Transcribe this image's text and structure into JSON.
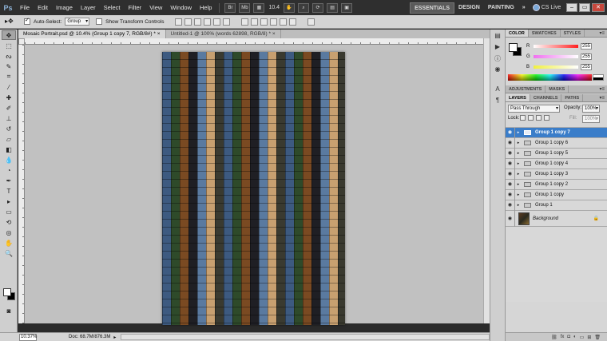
{
  "app": {
    "logo": "Ps"
  },
  "menu": [
    "File",
    "Edit",
    "Image",
    "Layer",
    "Select",
    "Filter",
    "View",
    "Window",
    "Help"
  ],
  "appbar": {
    "zoom": "10.4"
  },
  "workspace": {
    "items": [
      "ESSENTIALS",
      "DESIGN",
      "PAINTING",
      "»"
    ],
    "cslive": "CS Live"
  },
  "options": {
    "auto_select_label": "Auto-Select:",
    "auto_select_value": "Group",
    "transform_label": "Show Transform Controls"
  },
  "tabs": [
    {
      "label": "Mosaic Portrait.psd @ 10.4% (Group 1 copy 7, RGB/8#) *",
      "close": "×"
    },
    {
      "label": "Untitled-1 @ 100% (words 62898, RGB/8) *",
      "close": "×"
    }
  ],
  "status": {
    "zoom": "10.37%",
    "doc": "Doc: 68.7M/876.3M"
  },
  "color_panel": {
    "tabs": [
      "COLOR",
      "SWATCHES",
      "STYLES"
    ],
    "rows": [
      {
        "letter": "R",
        "value": "255",
        "color": "#ff2020"
      },
      {
        "letter": "G",
        "value": "255",
        "color": "#20ff20"
      },
      {
        "letter": "B",
        "value": "255",
        "color": "#3030ff"
      }
    ]
  },
  "adjust_tabs": [
    "ADJUSTMENTS",
    "MASKS"
  ],
  "layers_panel": {
    "tabs": [
      "LAYERS",
      "CHANNELS",
      "PATHS"
    ],
    "blend_mode": "Pass Through",
    "opacity_label": "Opacity:",
    "opacity": "100%",
    "lock_label": "Lock:",
    "fill_label": "Fill:",
    "fill": "100%",
    "layers": [
      {
        "name": "Group 1 copy 7",
        "selected": true
      },
      {
        "name": "Group 1 copy 6"
      },
      {
        "name": "Group 1 copy 5"
      },
      {
        "name": "Group 1 copy 4"
      },
      {
        "name": "Group 1 copy 3"
      },
      {
        "name": "Group 1 copy 2"
      },
      {
        "name": "Group 1 copy"
      },
      {
        "name": "Group 1"
      }
    ],
    "background": "Background"
  },
  "colors": {
    "selection": "#3a7dc9",
    "foreground": "#ffffff",
    "background": "#000000"
  }
}
